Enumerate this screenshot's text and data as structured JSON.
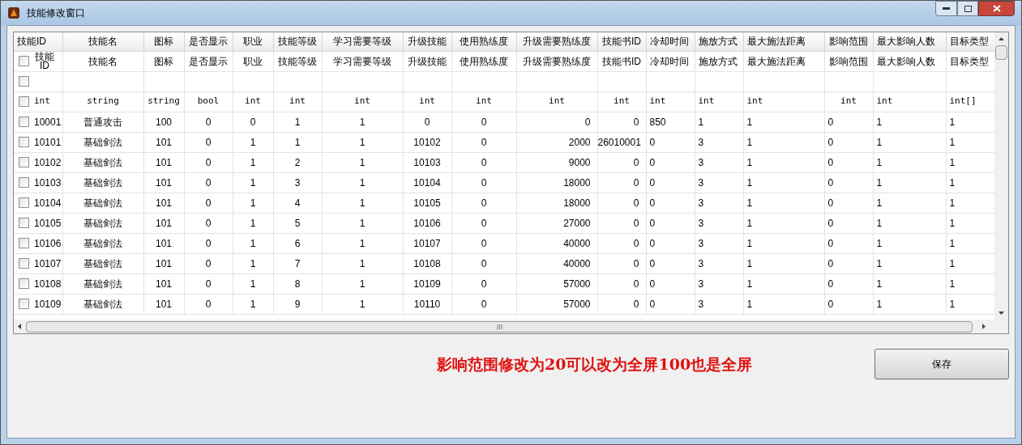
{
  "window": {
    "title": "技能修改窗口"
  },
  "columns": [
    "技能ID",
    "技能名",
    "图标",
    "是否显示",
    "职业",
    "技能等级",
    "学习需要等级",
    "升级技能",
    "使用熟练度",
    "升级需要熟练度",
    "技能书ID",
    "冷却时间",
    "施放方式",
    "最大施法距离",
    "影响范围",
    "最大影响人数",
    "目标类型"
  ],
  "meta_rows": [
    {
      "checked": false,
      "cells": [
        "技能ID",
        "技能名",
        "图标",
        "是否显示",
        "职业",
        "技能等级",
        "学习需要等级",
        "升级技能",
        "使用熟练度",
        "升级需要熟练度",
        "技能书ID",
        "冷却时间",
        "施放方式",
        "最大施法距离",
        "影响范围",
        "最大影响人数",
        "目标类型"
      ]
    },
    {
      "checked": false,
      "cells": []
    },
    {
      "checked": false,
      "kind": "type",
      "cells": [
        "int",
        "string",
        "string",
        "bool",
        "int",
        "int",
        "int",
        "int",
        "int",
        "int",
        "int",
        "int",
        "int",
        "int",
        "int",
        "int",
        "int[]"
      ]
    }
  ],
  "rows": [
    {
      "checked": false,
      "cells": [
        "10001",
        "普通攻击",
        "100",
        "0",
        "0",
        "1",
        "1",
        "0",
        "0",
        "0",
        "0",
        "850",
        "1",
        "1",
        "0",
        "1",
        "1"
      ]
    },
    {
      "checked": false,
      "cells": [
        "10101",
        "基础剑法",
        "101",
        "0",
        "1",
        "1",
        "1",
        "10102",
        "0",
        "2000",
        "26010001",
        "0",
        "3",
        "1",
        "0",
        "1",
        "1"
      ]
    },
    {
      "checked": false,
      "cells": [
        "10102",
        "基础剑法",
        "101",
        "0",
        "1",
        "2",
        "1",
        "10103",
        "0",
        "9000",
        "0",
        "0",
        "3",
        "1",
        "0",
        "1",
        "1"
      ]
    },
    {
      "checked": false,
      "cells": [
        "10103",
        "基础剑法",
        "101",
        "0",
        "1",
        "3",
        "1",
        "10104",
        "0",
        "18000",
        "0",
        "0",
        "3",
        "1",
        "0",
        "1",
        "1"
      ]
    },
    {
      "checked": false,
      "cells": [
        "10104",
        "基础剑法",
        "101",
        "0",
        "1",
        "4",
        "1",
        "10105",
        "0",
        "18000",
        "0",
        "0",
        "3",
        "1",
        "0",
        "1",
        "1"
      ]
    },
    {
      "checked": false,
      "cells": [
        "10105",
        "基础剑法",
        "101",
        "0",
        "1",
        "5",
        "1",
        "10106",
        "0",
        "27000",
        "0",
        "0",
        "3",
        "1",
        "0",
        "1",
        "1"
      ]
    },
    {
      "checked": false,
      "cells": [
        "10106",
        "基础剑法",
        "101",
        "0",
        "1",
        "6",
        "1",
        "10107",
        "0",
        "40000",
        "0",
        "0",
        "3",
        "1",
        "0",
        "1",
        "1"
      ]
    },
    {
      "checked": false,
      "cells": [
        "10107",
        "基础剑法",
        "101",
        "0",
        "1",
        "7",
        "1",
        "10108",
        "0",
        "40000",
        "0",
        "0",
        "3",
        "1",
        "0",
        "1",
        "1"
      ]
    },
    {
      "checked": false,
      "cells": [
        "10108",
        "基础剑法",
        "101",
        "0",
        "1",
        "8",
        "1",
        "10109",
        "0",
        "57000",
        "0",
        "0",
        "3",
        "1",
        "0",
        "1",
        "1"
      ]
    },
    {
      "checked": false,
      "cells": [
        "10109",
        "基础剑法",
        "101",
        "0",
        "1",
        "9",
        "1",
        "10110",
        "0",
        "57000",
        "0",
        "0",
        "3",
        "1",
        "0",
        "1",
        "1"
      ]
    }
  ],
  "note": "影响范围修改为20可以改为全屏100也是全屏",
  "save_button": "保存"
}
